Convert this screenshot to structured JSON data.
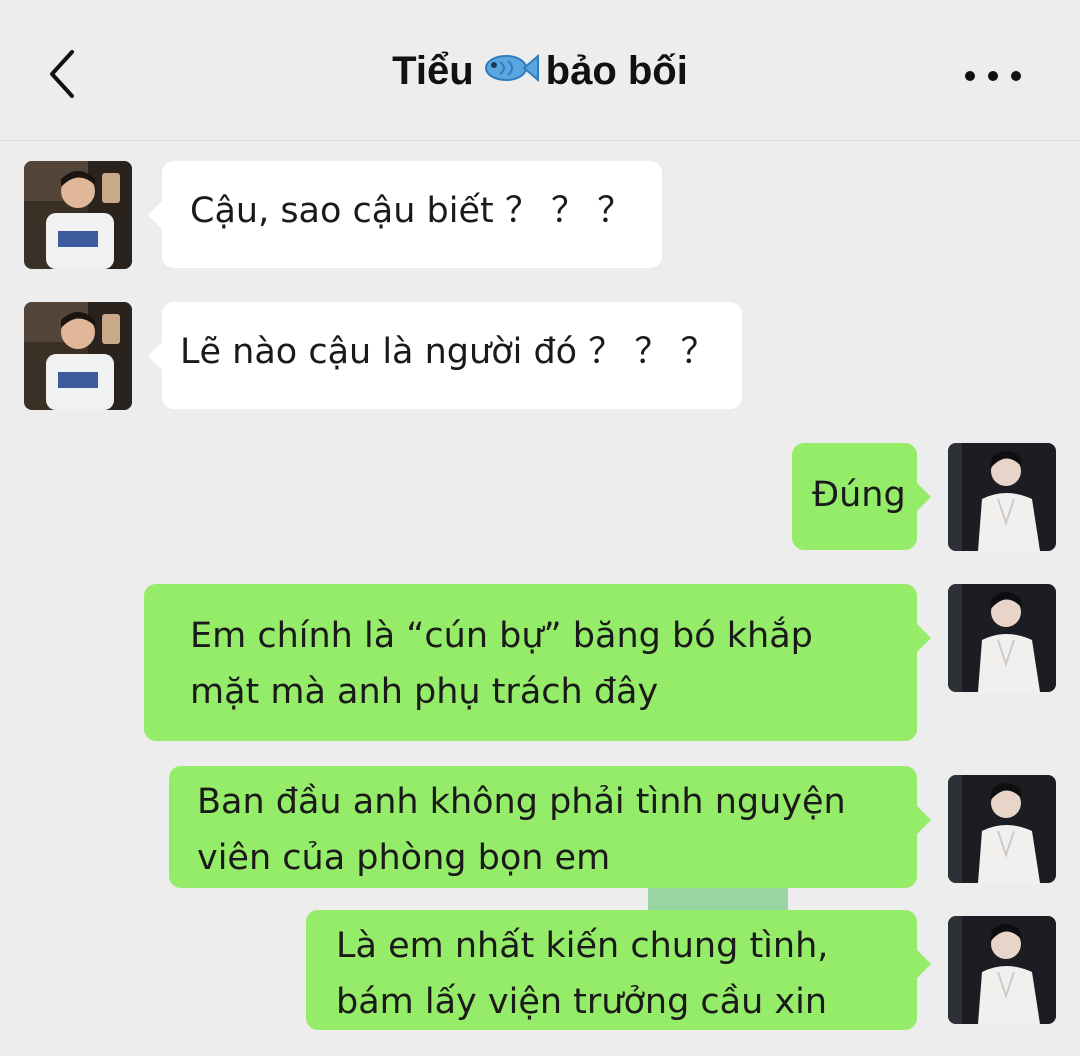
{
  "header": {
    "title_before": "Tiểu",
    "title_icon": "fish-emoji",
    "title_after": "bảo bối",
    "back_icon": "chevron-left-icon",
    "more_icon": "ellipsis-icon"
  },
  "colors": {
    "background": "#ededed",
    "incoming_bubble": "#ffffff",
    "outgoing_bubble": "#95ec69"
  },
  "messages": [
    {
      "side": "incoming",
      "text": "Cậu, sao cậu biết ？ ？ ？"
    },
    {
      "side": "incoming",
      "text": "Lẽ nào cậu là người đó ？ ？ ？"
    },
    {
      "side": "outgoing",
      "text": "Đúng"
    },
    {
      "side": "outgoing",
      "text": "Em chính là “cún bự” băng bó khắp mặt mà anh phụ trách đây"
    },
    {
      "side": "outgoing",
      "text": "Ban đầu anh không phải tình nguyện viên của phòng bọn em"
    },
    {
      "side": "outgoing",
      "text": "Là em nhất kiến chung tình, bám lấy viện trưởng cầu xin"
    }
  ]
}
